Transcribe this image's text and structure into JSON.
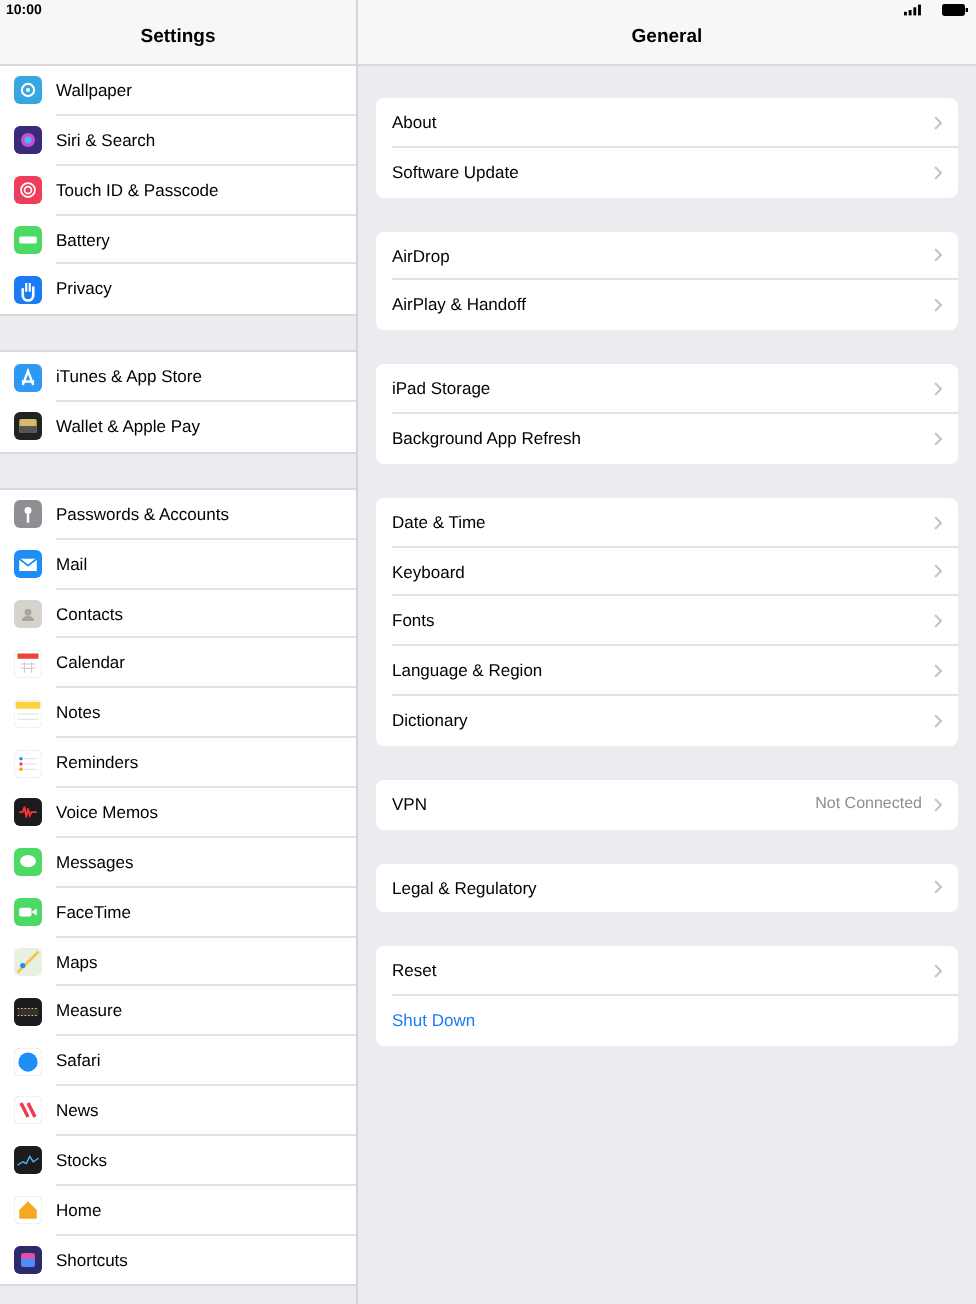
{
  "status_bar": {
    "time": "10:00"
  },
  "sidebar": {
    "title": "Settings",
    "groups": [
      {
        "items": [
          "Wallpaper",
          "Siri & Search",
          "Touch ID & Passcode",
          "Battery",
          "Privacy"
        ]
      },
      {
        "items": [
          "iTunes & App Store",
          "Wallet & Apple Pay"
        ]
      },
      {
        "items": [
          "Passwords & Accounts",
          "Mail",
          "Contacts",
          "Calendar",
          "Notes",
          "Reminders",
          "Voice Memos",
          "Messages",
          "FaceTime",
          "Maps",
          "Measure",
          "Safari",
          "News",
          "Stocks",
          "Home",
          "Shortcuts"
        ]
      }
    ]
  },
  "detail": {
    "title": "General",
    "groups": [
      {
        "rows": [
          {
            "kind": "link",
            "label": "About"
          },
          {
            "kind": "link",
            "label": "Software Update"
          }
        ]
      },
      {
        "rows": [
          {
            "kind": "link",
            "label": "AirDrop"
          },
          {
            "kind": "link",
            "label": "AirPlay & Handoff"
          }
        ]
      },
      {
        "rows": [
          {
            "kind": "link",
            "label": "iPad Storage"
          },
          {
            "kind": "link",
            "label": "Background App Refresh"
          }
        ]
      },
      {
        "rows": [
          {
            "kind": "link",
            "label": "Date & Time"
          },
          {
            "kind": "link",
            "label": "Keyboard"
          },
          {
            "kind": "link",
            "label": "Fonts"
          },
          {
            "kind": "link",
            "label": "Language & Region"
          },
          {
            "kind": "link",
            "label": "Dictionary"
          }
        ]
      },
      {
        "rows": [
          {
            "kind": "link",
            "label": "VPN",
            "value": "Not Connected"
          }
        ]
      },
      {
        "rows": [
          {
            "kind": "link",
            "label": "Legal & Regulatory"
          }
        ]
      },
      {
        "rows": [
          {
            "kind": "link",
            "label": "Reset"
          },
          {
            "kind": "action",
            "label": "Shut Down"
          }
        ]
      }
    ]
  }
}
